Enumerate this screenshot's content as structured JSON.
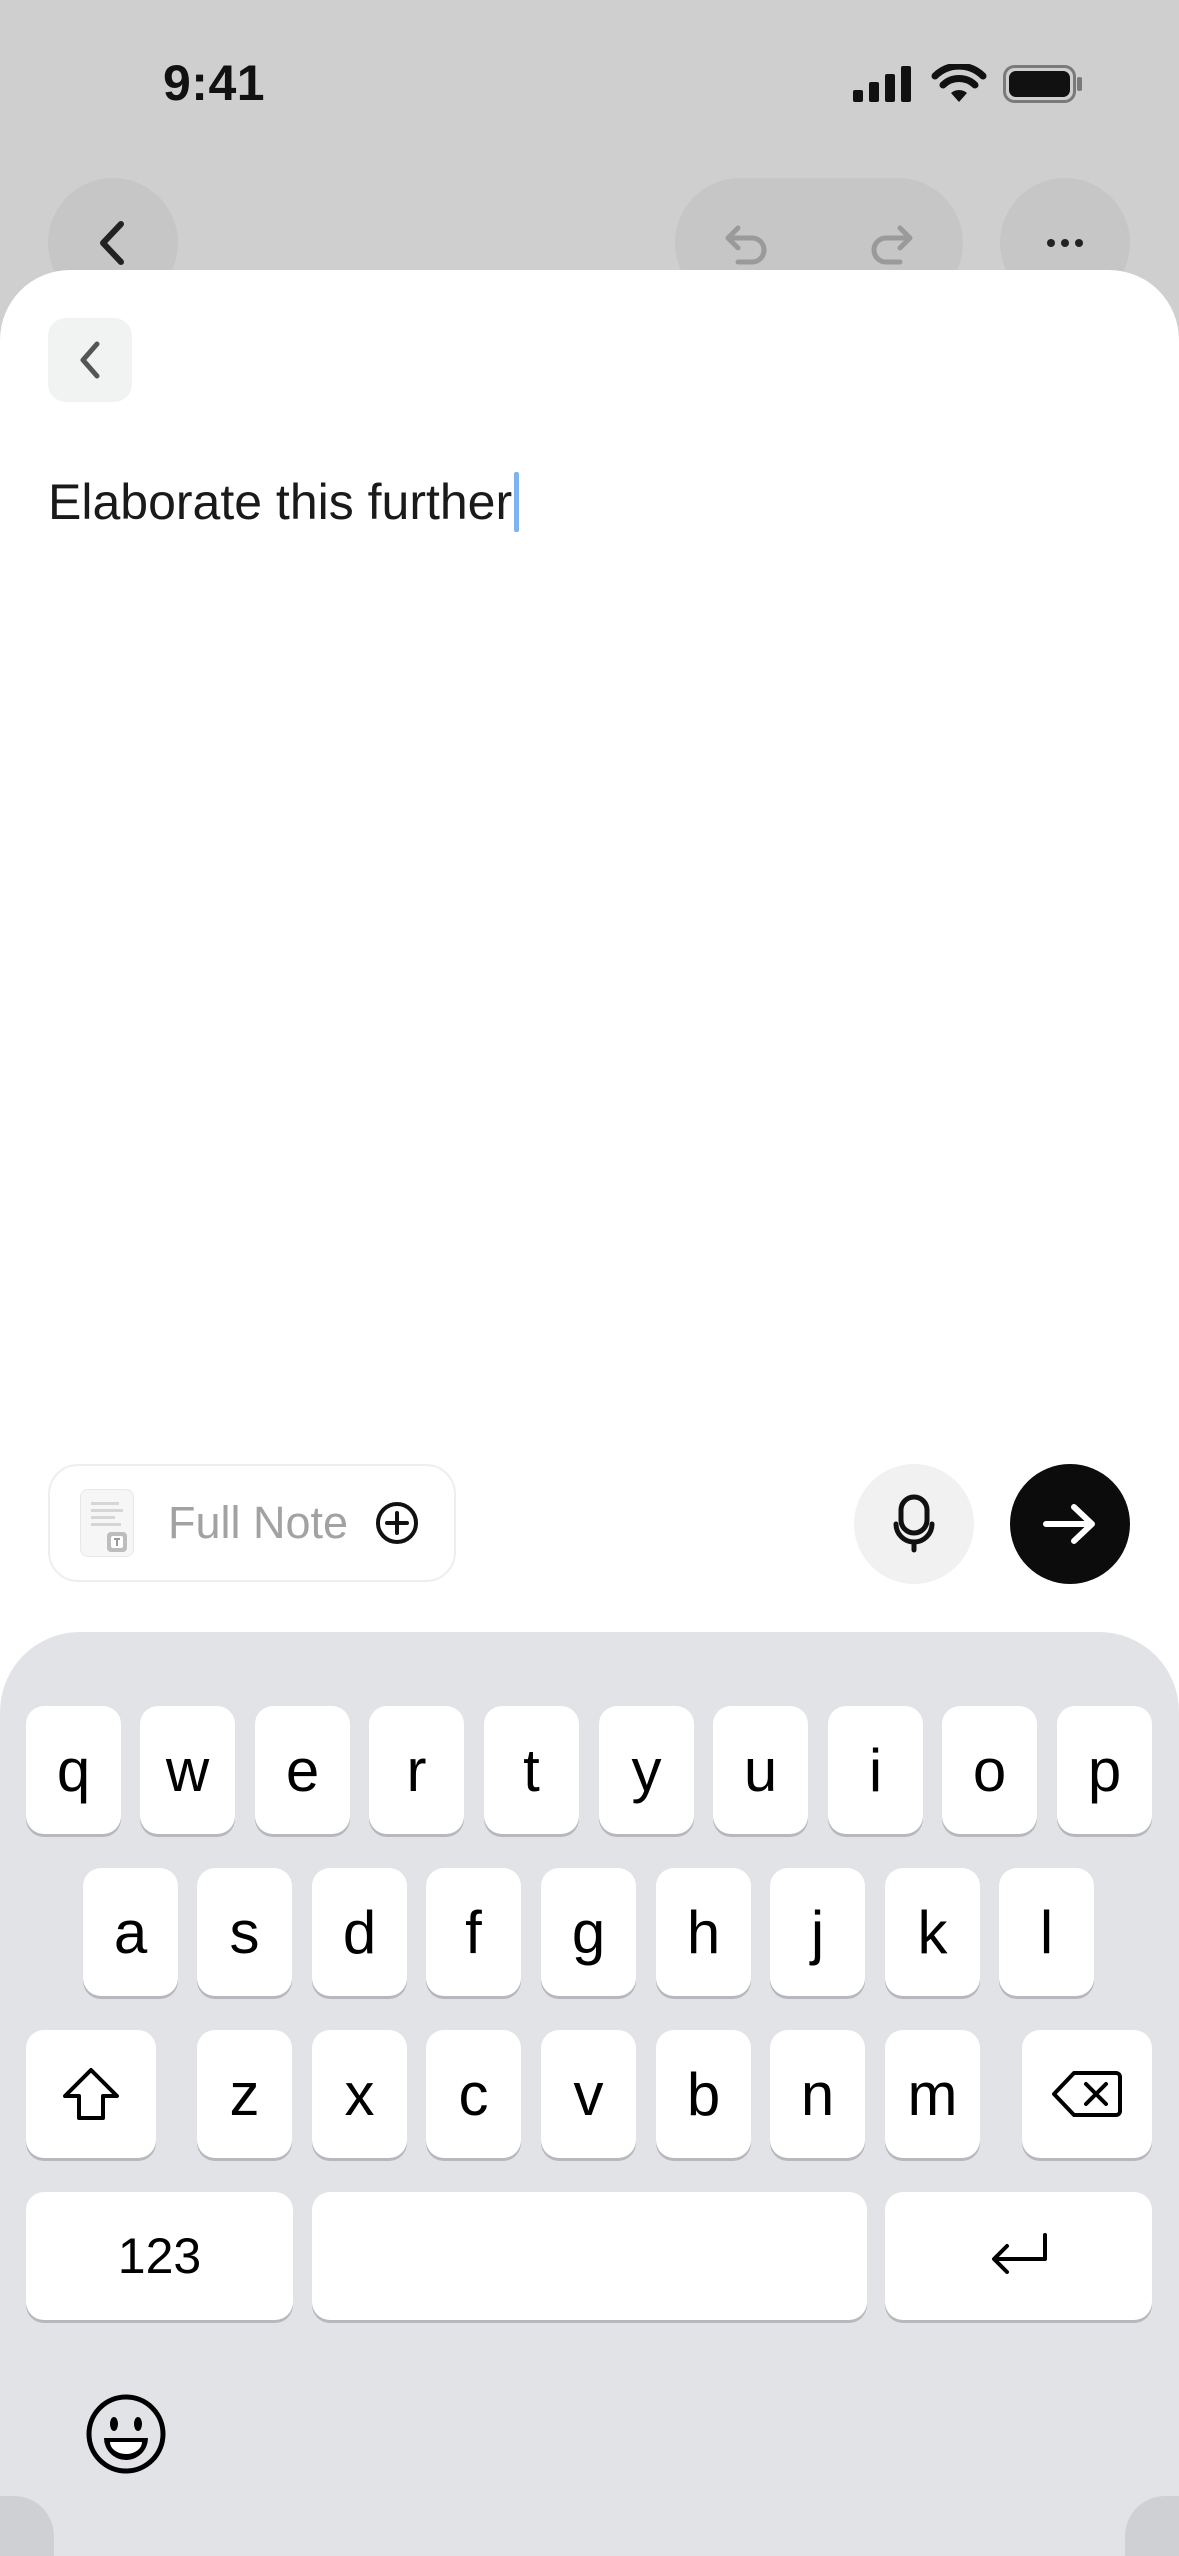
{
  "status_bar": {
    "time": "9:41"
  },
  "composer": {
    "prompt_text": "Elaborate this further",
    "context_chip_label": "Full Note"
  },
  "keyboard": {
    "row1": [
      "q",
      "w",
      "e",
      "r",
      "t",
      "y",
      "u",
      "i",
      "o",
      "p"
    ],
    "row2": [
      "a",
      "s",
      "d",
      "f",
      "g",
      "h",
      "j",
      "k",
      "l"
    ],
    "row3": [
      "z",
      "x",
      "c",
      "v",
      "b",
      "n",
      "m"
    ],
    "numbers_key": "123"
  },
  "colors": {
    "caret": "#7fb3f0",
    "send_button": "#0c0c0c",
    "keyboard_bg": "#e2e3e7"
  },
  "icons": [
    "chevron-left-icon",
    "undo-icon",
    "redo-icon",
    "more-icon",
    "mic-icon",
    "arrow-right-icon",
    "plus-circle-icon",
    "shift-icon",
    "delete-icon",
    "return-icon",
    "emoji-icon"
  ]
}
